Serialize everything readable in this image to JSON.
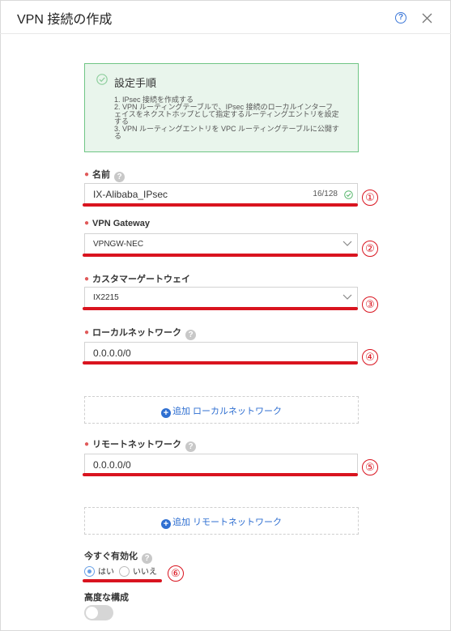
{
  "dialog": {
    "title": "VPN 接続の作成",
    "help": "?"
  },
  "info": {
    "title": "設定手順",
    "steps": [
      "1. IPsec 接続を作成する",
      "2. VPN ルーティングテーブルで、IPsec 接続のローカルインターフェイスをネクストホップとして指定するルーティングエントリを設定する",
      "3. VPN ルーティングエントリを VPC ルーティングテーブルに公開する"
    ]
  },
  "form": {
    "name": {
      "label": "名前",
      "value": "IX-Alibaba_IPsec",
      "counter": "16/128"
    },
    "vpn_gateway": {
      "label": "VPN Gateway",
      "value": "VPNGW-NEC"
    },
    "customer_gateway": {
      "label": "カスタマーゲートウェイ",
      "value": "IX2215"
    },
    "local_network": {
      "label": "ローカルネットワーク",
      "value": "0.0.0.0/0",
      "add_label": "追加 ローカルネットワーク"
    },
    "remote_network": {
      "label": "リモートネットワーク",
      "value": "0.0.0.0/0",
      "add_label": "追加 リモートネットワーク"
    },
    "enable_now": {
      "label": "今すぐ有効化",
      "yes": "はい",
      "no": "いいえ",
      "selected": "はい"
    },
    "advanced": {
      "label": "高度な構成",
      "enabled": false
    }
  },
  "annotations": [
    "①",
    "②",
    "③",
    "④",
    "⑤",
    "⑥"
  ],
  "colors": {
    "accent": "#2f6fd1",
    "annotation": "#d9141f",
    "info_bg": "#e9f5ec",
    "info_border": "#6fc585",
    "required": "#e05a5a"
  }
}
